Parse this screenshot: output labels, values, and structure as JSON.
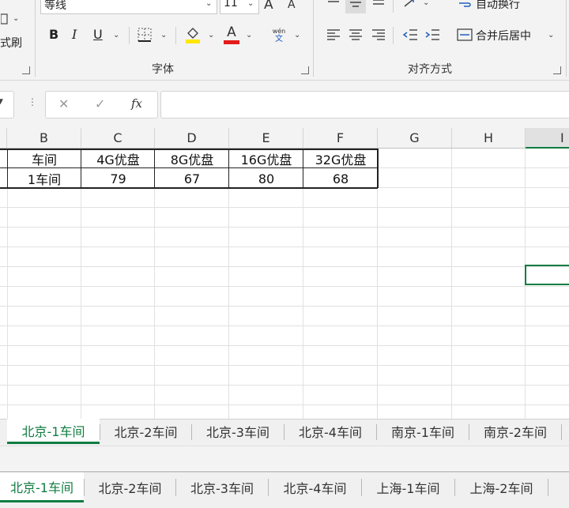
{
  "ribbon": {
    "font_name": "等线",
    "font_size": "11",
    "grow_font": "A",
    "shrink_font": "A",
    "bold": "B",
    "italic": "I",
    "underline": "U",
    "pinyin_top": "wén",
    "pinyin_bottom": "文",
    "font_color_letter": "A",
    "brush_partial": "式刷",
    "font_group_label": "字体",
    "wrap_text": "自动换行",
    "merge_center": "合并后居中",
    "align_group_label": "对齐方式",
    "colors": {
      "fill": "#ffe600",
      "font": "#e31b1b",
      "accent": "#107c41"
    }
  },
  "formula_bar": {
    "cancel": "✕",
    "enter": "✓",
    "fx": "fx",
    "value": ""
  },
  "grid": {
    "columns": [
      "B",
      "C",
      "D",
      "E",
      "F",
      "G",
      "H",
      "I"
    ],
    "header_row": [
      "车间",
      "4G优盘",
      "8G优盘",
      "16G优盘",
      "32G优盘"
    ],
    "data_row": [
      "1车间",
      "79",
      "67",
      "80",
      "68"
    ]
  },
  "sheet_tabs_window1": [
    "北京-1车间",
    "北京-2车间",
    "北京-3车间",
    "北京-4车间",
    "南京-1车间",
    "南京-2车间"
  ],
  "sheet_tabs_window2": [
    "北京-1车间",
    "北京-2车间",
    "北京-3车间",
    "北京-4车间",
    "上海-1车间",
    "上海-2车间"
  ]
}
